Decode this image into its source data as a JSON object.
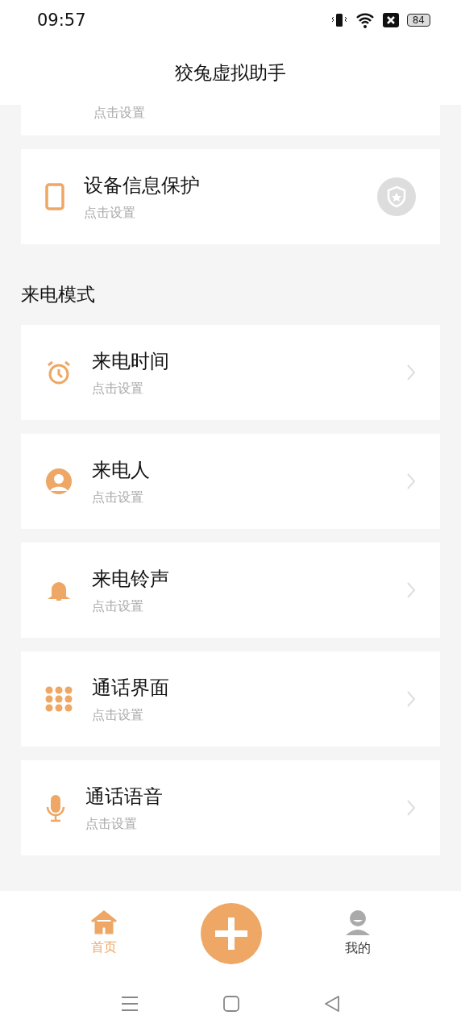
{
  "status_bar": {
    "time": "09:57",
    "battery": "84"
  },
  "header": {
    "title": "狡兔虚拟助手"
  },
  "top_cards": [
    {
      "subtitle": "点击设置",
      "kind": "partial"
    },
    {
      "title": "设备信息保护",
      "subtitle": "点击设置",
      "kind": "badge"
    }
  ],
  "section": {
    "title": "来电模式"
  },
  "items": [
    {
      "title": "来电时间",
      "subtitle": "点击设置",
      "kind": "chevron"
    },
    {
      "title": "来电人",
      "subtitle": "点击设置",
      "kind": "chevron"
    },
    {
      "title": "来电铃声",
      "subtitle": "点击设置",
      "kind": "chevron"
    },
    {
      "title": "通话界面",
      "subtitle": "点击设置",
      "kind": "chevron"
    },
    {
      "title": "通话语音",
      "subtitle": "点击设置",
      "kind": "chevron"
    }
  ],
  "bottom_nav": [
    {
      "label": "首页",
      "selected": true,
      "kind": "tab"
    },
    {
      "kind": "add"
    },
    {
      "label": "我的",
      "selected": false,
      "kind": "tab"
    }
  ]
}
